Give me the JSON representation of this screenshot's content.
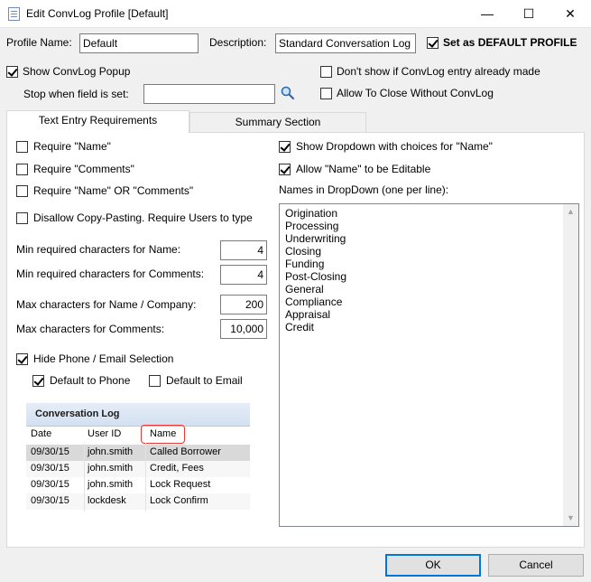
{
  "window": {
    "title": "Edit ConvLog Profile [Default]",
    "minimize": "—",
    "maximize": "☐",
    "close": "✕"
  },
  "profile": {
    "name_label": "Profile Name:",
    "name_value": "Default",
    "desc_label": "Description:",
    "desc_value": "Standard Conversation Log",
    "default_label": "Set as DEFAULT PROFILE",
    "default_checked": true
  },
  "options": {
    "show_popup": "Show ConvLog Popup",
    "stop_field_label": "Stop when field is set:",
    "stop_field_value": "",
    "dont_show": "Don't show if ConvLog entry already made",
    "allow_close": "Allow To Close Without ConvLog"
  },
  "tabs": [
    {
      "label": "Text Entry Requirements",
      "active": true
    },
    {
      "label": "Summary Section",
      "active": false
    }
  ],
  "left": {
    "req_name": "Require \"Name\"",
    "req_comments": "Require \"Comments\"",
    "req_either": "Require \"Name\" OR \"Comments\"",
    "disallow_paste": "Disallow Copy-Pasting.  Require Users to type",
    "min_name_label": "Min required characters for Name:",
    "min_name_value": "4",
    "min_comments_label": "Min required characters for Comments:",
    "min_comments_value": "4",
    "max_name_label": "Max characters for Name / Company:",
    "max_name_value": "200",
    "max_comments_label": "Max characters for Comments:",
    "max_comments_value": "10,000",
    "hide_phone": "Hide Phone / Email Selection",
    "default_phone": "Default to Phone",
    "default_email": "Default to Email"
  },
  "right": {
    "show_dropdown": "Show Dropdown with choices for \"Name\"",
    "allow_editable": "Allow \"Name\" to be Editable",
    "names_label": "Names in DropDown (one per line):",
    "names": [
      "Origination",
      "Processing",
      "Underwriting",
      "Closing",
      "Funding",
      "Post-Closing",
      "General",
      "Compliance",
      "Appraisal",
      "Credit"
    ]
  },
  "convlog_preview": {
    "title": "Conversation Log",
    "columns": [
      "Date",
      "User ID",
      "Name"
    ],
    "rows": [
      [
        "09/30/15",
        "john.smith",
        "Called Borrower"
      ],
      [
        "09/30/15",
        "john.smith",
        "Credit, Fees"
      ],
      [
        "09/30/15",
        "john.smith",
        "Lock Request"
      ],
      [
        "09/30/15",
        "lockdesk",
        "Lock Confirm"
      ]
    ]
  },
  "buttons": {
    "ok": "OK",
    "cancel": "Cancel"
  },
  "colors": {
    "accent": "#0078d7",
    "highlight": "#e53935"
  }
}
